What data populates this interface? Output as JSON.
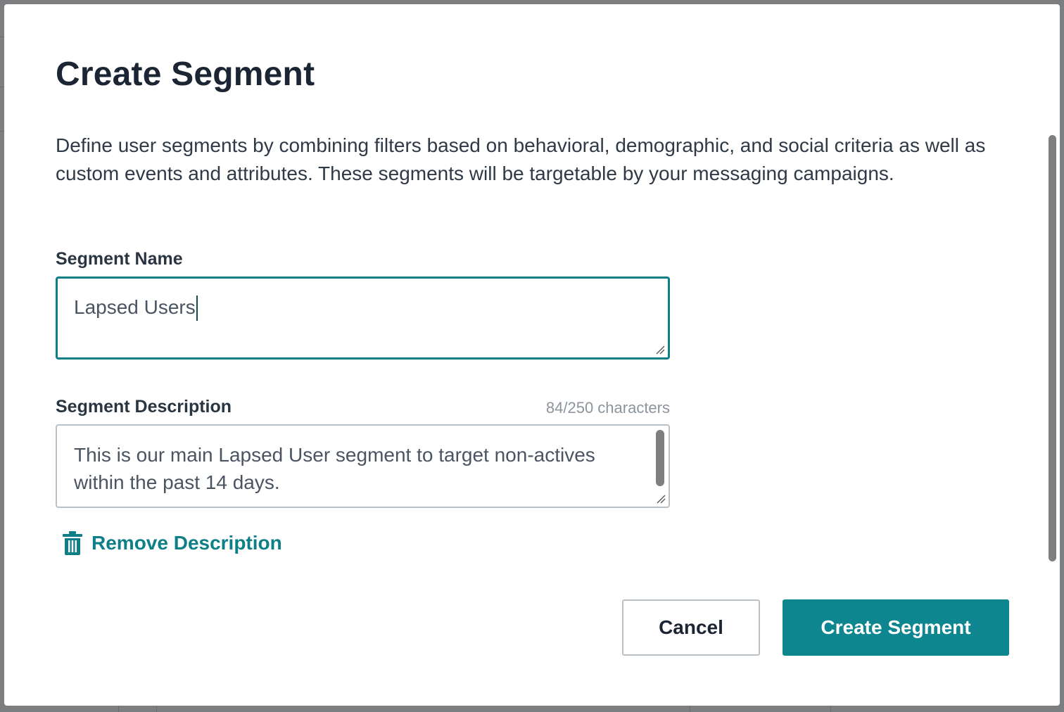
{
  "modal": {
    "title": "Create Segment",
    "description": "Define user segments by combining filters based on behavioral, demographic, and social criteria as well as custom events and attributes. These segments will be targetable by your messaging campaigns."
  },
  "segment_name": {
    "label": "Segment Name",
    "value": "Lapsed Users"
  },
  "segment_description": {
    "label": "Segment Description",
    "char_count": "84/250 characters",
    "value": "This is our main Lapsed User segment to target non-actives within the past 14 days."
  },
  "remove_description": {
    "label": "Remove Description",
    "icon": "trash-icon"
  },
  "buttons": {
    "cancel": "Cancel",
    "create": "Create Segment"
  },
  "colors": {
    "accent": "#0e8690",
    "title": "#1b2533",
    "muted": "#8c949c"
  }
}
